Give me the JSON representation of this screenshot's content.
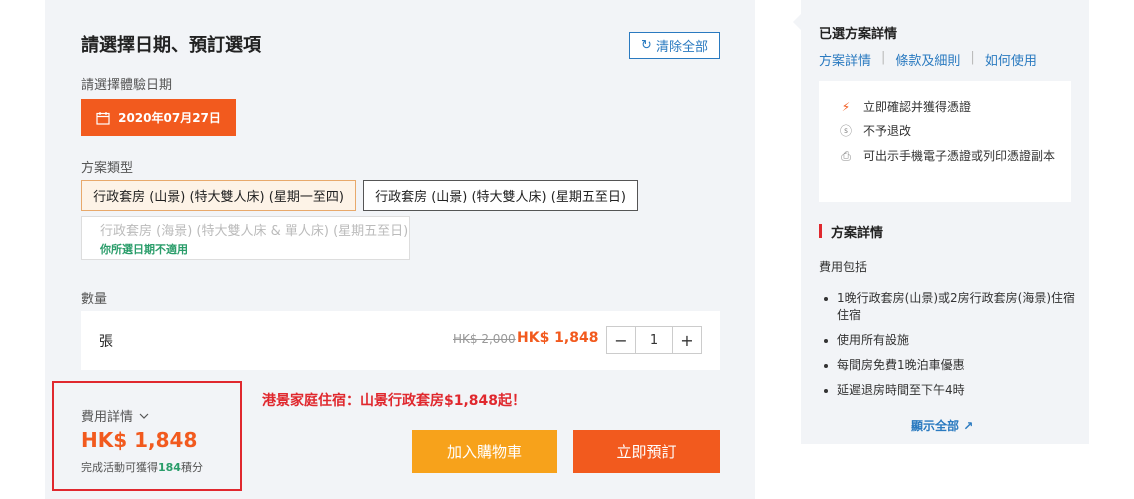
{
  "booking": {
    "title": "請選擇日期、預訂選項",
    "clear_all": "清除全部",
    "date_label": "請選擇體驗日期",
    "date_value": "2020年07月27日",
    "package_label": "方案類型",
    "options": [
      {
        "label": "行政套房 (山景) (特大雙人床) (星期一至四)",
        "state": "selected"
      },
      {
        "label": "行政套房 (山景) (特大雙人床) (星期五至日)",
        "state": "normal"
      },
      {
        "label": "行政套房 (海景) (特大雙人床 & 單人床) (星期五至日)",
        "state": "disabled",
        "note": "你所選日期不適用"
      }
    ],
    "quantity_label": "數量",
    "unit": "張",
    "original_price": "HK$ 2,000",
    "price": "HK$ 1,848",
    "quantity": "1",
    "minus": "−",
    "plus": "+"
  },
  "fee": {
    "label": "費用詳情",
    "total": "HK$ 1,848",
    "points_prefix": "完成活動可獲得",
    "points": "184",
    "points_suffix": "積分"
  },
  "promo_text": "港景家庭住宿：山景行政套房$1,848起！",
  "actions": {
    "add_to_cart": "加入購物車",
    "book_now": "立即預訂"
  },
  "summary": {
    "title": "已選方案詳情",
    "links": [
      "方案詳情",
      "條款及細則",
      "如何使用"
    ],
    "features": [
      {
        "icon": "lightning-icon",
        "text": "立即確認并獲得憑證"
      },
      {
        "icon": "dollar-icon",
        "text": "不予退改"
      },
      {
        "icon": "printer-icon",
        "text": "可出示手機電子憑證或列印憑證副本"
      }
    ],
    "details_title": "方案詳情",
    "fee_includes": "費用包括",
    "includes": [
      "1晚行政套房(山景)或2房行政套房(海景)住宿住宿",
      "使用所有設施",
      "每間房免費1晚泊車優惠",
      "延遲退房時間至下午4時"
    ],
    "show_all": "顯示全部"
  },
  "colors": {
    "accent_orange": "#f25a1e",
    "cart_yellow": "#f7a21b",
    "link_blue": "#2a7ac0",
    "points_green": "#2a9d6a",
    "highlight_red": "#e0282e"
  }
}
